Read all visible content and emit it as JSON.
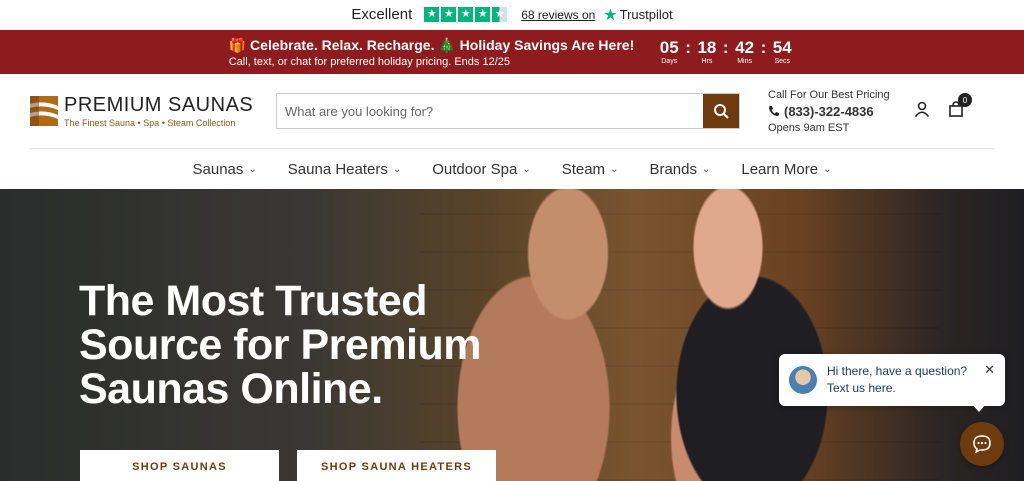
{
  "trustpilot": {
    "rating_word": "Excellent",
    "reviews_link": "68 reviews on",
    "brand": "Trustpilot",
    "stars": 4.5
  },
  "promo": {
    "title": "🎁 Celebrate. Relax. Recharge. 🎄 Holiday Savings Are Here!",
    "subtitle": "Call, text, or chat for preferred holiday pricing. Ends 12/25",
    "countdown": [
      {
        "value": "05",
        "label": "Days"
      },
      {
        "value": "18",
        "label": "Hrs"
      },
      {
        "value": "42",
        "label": "Mins"
      },
      {
        "value": "54",
        "label": "Secs"
      }
    ],
    "background_color": "#8e1c1e"
  },
  "header": {
    "logo_name": "PREMIUM SAUNAS",
    "logo_tagline": "The Finest Sauna • Spa • Steam Collection",
    "search_placeholder": "What are you looking for?",
    "contact_title": "Call For Our Best Pricing",
    "phone": "(833)-322-4836",
    "hours": "Opens 9am EST",
    "cart_count": "0",
    "accent_color": "#6e3b0f"
  },
  "nav": {
    "items": [
      {
        "label": "Saunas"
      },
      {
        "label": "Sauna Heaters"
      },
      {
        "label": "Outdoor Spa"
      },
      {
        "label": "Steam"
      },
      {
        "label": "Brands"
      },
      {
        "label": "Learn More"
      }
    ]
  },
  "hero": {
    "title": "The Most Trusted Source for Premium Saunas Online.",
    "button_1": "SHOP SAUNAS",
    "button_2": "SHOP SAUNA HEATERS"
  },
  "chat": {
    "line1": "Hi there, have a question?",
    "line2": "Text us here."
  }
}
